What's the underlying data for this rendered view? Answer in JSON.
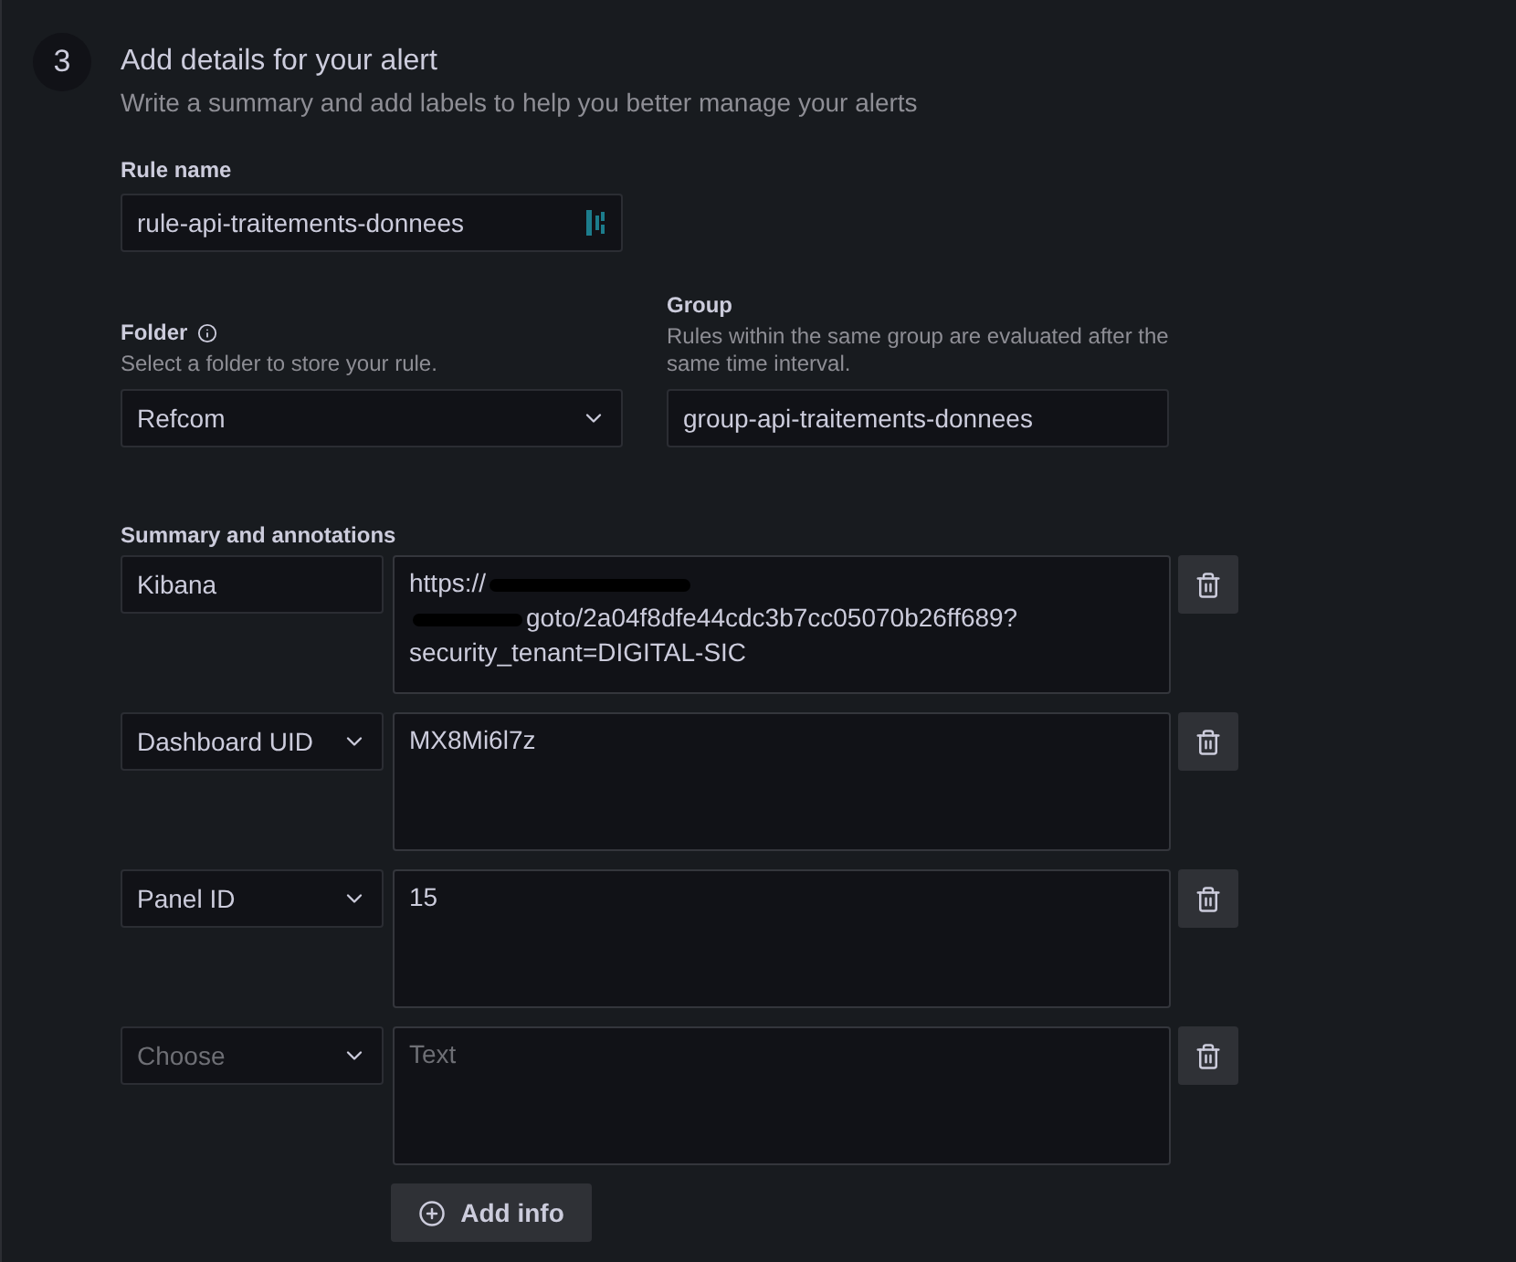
{
  "step": {
    "number": "3",
    "title": "Add details for your alert",
    "subtitle": "Write a summary and add labels to help you better manage your alerts"
  },
  "rule_name": {
    "label": "Rule name",
    "value": "rule-api-traitements-donnees"
  },
  "folder": {
    "label": "Folder",
    "description": "Select a folder to store your rule.",
    "value": "Refcom"
  },
  "group": {
    "label": "Group",
    "description": "Rules within the same group are evaluated after the same time interval.",
    "value": "group-api-traitements-donnees"
  },
  "annotations": {
    "label": "Summary and annotations",
    "rows": [
      {
        "key": {
          "kind": "text",
          "value": "Kibana"
        },
        "lines": [
          {
            "text": "https://",
            "redacted": true
          },
          {
            "text": "goto/2a04f8dfe44cdc3b7cc05070b26ff689?",
            "redacted": true
          },
          {
            "text": "security_tenant=DIGITAL-SIC",
            "redacted": false
          }
        ]
      },
      {
        "key": {
          "kind": "select",
          "value": "Dashboard UID"
        },
        "lines": [
          {
            "text": "MX8Mi6l7z",
            "redacted": false
          }
        ]
      },
      {
        "key": {
          "kind": "select",
          "value": "Panel ID"
        },
        "lines": [
          {
            "text": "15",
            "redacted": false
          }
        ]
      },
      {
        "key": {
          "kind": "select",
          "placeholder": "Choose"
        },
        "placeholder": "Text"
      }
    ],
    "add_button": "Add info"
  }
}
